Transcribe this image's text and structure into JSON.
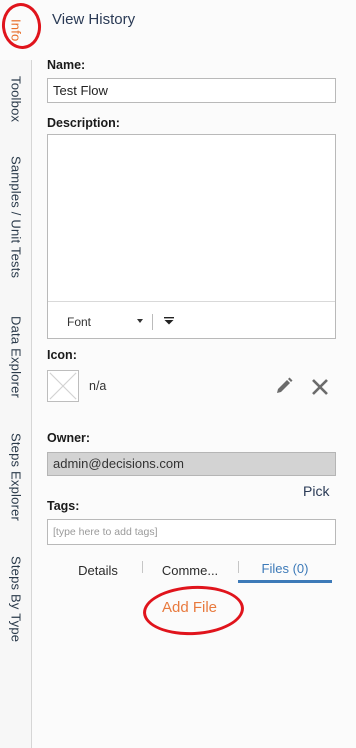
{
  "sidebar_tabs": [
    {
      "label": "Info",
      "active": true
    },
    {
      "label": "Toolbox"
    },
    {
      "label": "Samples / Unit Tests"
    },
    {
      "label": "Data Explorer"
    },
    {
      "label": "Steps Explorer"
    },
    {
      "label": "Steps By Type"
    }
  ],
  "header": {
    "view_history": "View History"
  },
  "form": {
    "name_label": "Name:",
    "name_value": "Test Flow",
    "description_label": "Description:",
    "font_label": "Font",
    "icon_label": "Icon:",
    "icon_value": "n/a",
    "owner_label": "Owner:",
    "owner_value": "admin@decisions.com",
    "pick_label": "Pick",
    "tags_label": "Tags:",
    "tags_placeholder": "[type here to add tags]"
  },
  "tabs": [
    {
      "label": "Details"
    },
    {
      "label": "Comme..."
    },
    {
      "label": "Files (0)",
      "active": true
    }
  ],
  "files": {
    "add_file": "Add File"
  },
  "colors": {
    "accent_orange": "#e86e2a",
    "tab_blue": "#3d7ab8",
    "annotation_red": "#e0141c"
  }
}
